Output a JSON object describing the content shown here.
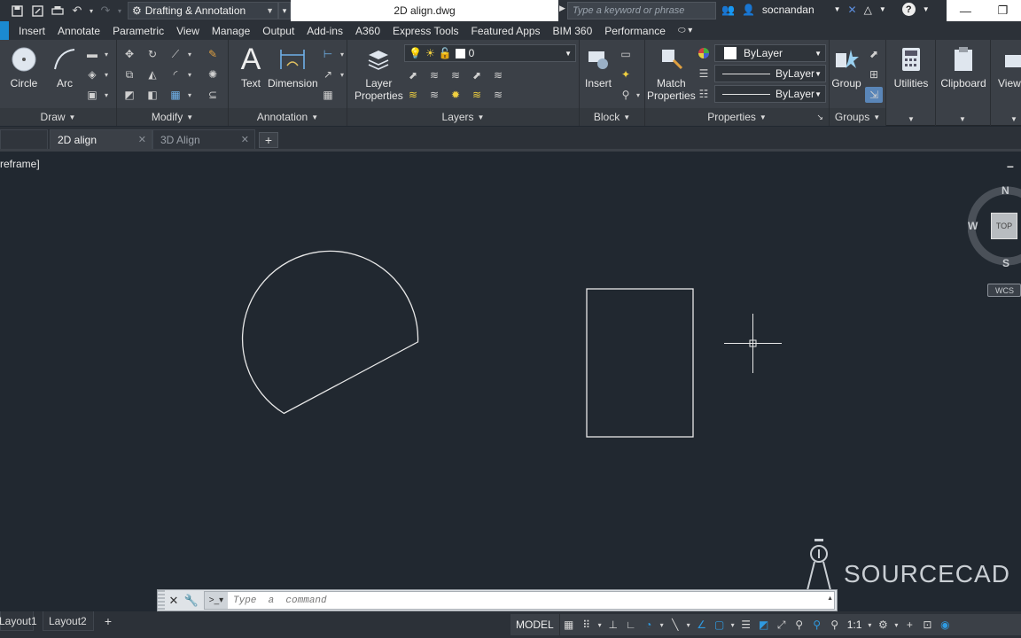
{
  "title_bar": {
    "workspace": "Drafting & Annotation",
    "document_title": "2D align.dwg",
    "search_placeholder": "Type a keyword or phrase",
    "username": "socnandan"
  },
  "ribbon_tabs": [
    "Insert",
    "Annotate",
    "Parametric",
    "View",
    "Manage",
    "Output",
    "Add-ins",
    "A360",
    "Express Tools",
    "Featured Apps",
    "BIM 360",
    "Performance"
  ],
  "ribbon": {
    "draw": {
      "title": "Draw",
      "circle": "Circle",
      "arc": "Arc"
    },
    "modify": {
      "title": "Modify"
    },
    "annotation": {
      "title": "Annotation",
      "text": "Text",
      "dimension": "Dimension"
    },
    "layers": {
      "title": "Layers",
      "layer_properties_1": "Layer",
      "layer_properties_2": "Properties",
      "current_layer": "0"
    },
    "block": {
      "title": "Block",
      "insert": "Insert"
    },
    "properties": {
      "title": "Properties",
      "match_1": "Match",
      "match_2": "Properties",
      "color": "ByLayer",
      "linetype": "ByLayer",
      "lineweight": "ByLayer"
    },
    "groups": {
      "title": "Groups",
      "group": "Group"
    },
    "utilities": "Utilities",
    "clipboard": "Clipboard",
    "view_stub": "View"
  },
  "file_tabs": [
    {
      "label": "2D align",
      "active": true
    },
    {
      "label": "3D Align",
      "active": false
    }
  ],
  "viewport": {
    "label": "reframe]"
  },
  "viewcube": {
    "north": "N",
    "south": "S",
    "west": "W",
    "face": "TOP",
    "ucs": "WCS"
  },
  "watermark": "SOURCECAD",
  "command_line": {
    "placeholder": "Type  a  command"
  },
  "layout_tabs": [
    "Layout1",
    "Layout2"
  ],
  "status_bar": {
    "model": "MODEL",
    "scale": "1:1"
  },
  "colors": {
    "canvas": "#212830",
    "chrome": "#2c3138",
    "ribbon": "#3b4047",
    "accent_blue": "#1b8ad0",
    "drawing_line": "#e8e8e8"
  }
}
